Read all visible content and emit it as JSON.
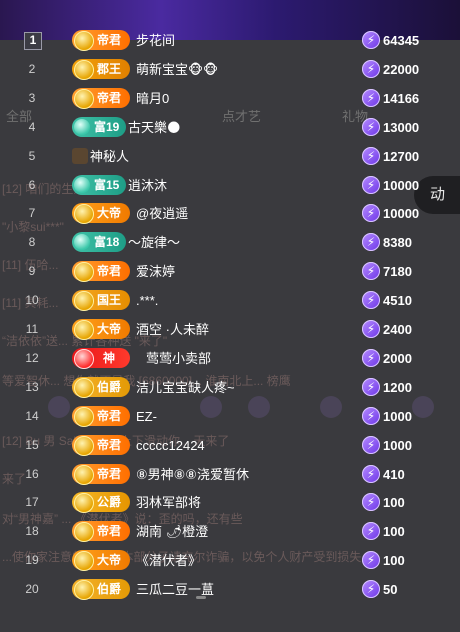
{
  "background_page": {
    "tabs": [
      "全部",
      "点才艺",
      "礼物"
    ],
    "live_button": "动",
    "chat_lines": [
      "[12] 咱们的生活",
      "\"小黎sui***\"",
      "[11] 伍哈...",
      "[11] 冥耗...",
      "“洁依依”送... 累计各种送 \"来了\"",
      "等爱智休... 想你就不是我 [6860000]...  淮南北上... 榜鹰",
      "[12] Bu 男 Salary 通过上下滑动你...  天来了",
      "来了",
      "对“男神嘉” ... 《潜伏者》说：歪的吗，还有些",
      "...使你家注意的... 金网本部分子请充尔诈骗，以免个人财产受到损失"
    ]
  },
  "rank_list": [
    {
      "rank": "1",
      "title": "帝君",
      "name": "步花间",
      "score": "64345",
      "badge": "dizun"
    },
    {
      "rank": "2",
      "title": "郡王",
      "name": "萌新宝宝🐵🐵",
      "score": "22000",
      "badge": "junwang"
    },
    {
      "rank": "3",
      "title": "帝君",
      "name": "暗月0",
      "score": "14166",
      "badge": "dizun"
    },
    {
      "rank": "4",
      "title": "富19",
      "name": "古天樂🌑",
      "score": "13000",
      "badge": "fu"
    },
    {
      "rank": "5",
      "title": "",
      "name": "神秘人",
      "score": "12700",
      "badge": "avatar"
    },
    {
      "rank": "6",
      "title": "富15",
      "name": "逍沐沐",
      "score": "10000",
      "badge": "fu"
    },
    {
      "rank": "7",
      "title": "大帝",
      "name": "@夜逍遥",
      "score": "10000",
      "badge": "dadi"
    },
    {
      "rank": "8",
      "title": "富18",
      "name": "～旋律～",
      "score": "8380",
      "badge": "fu"
    },
    {
      "rank": "9",
      "title": "帝君",
      "name": "爱沫婷",
      "score": "7180",
      "badge": "dizun"
    },
    {
      "rank": "10",
      "title": "国王",
      "name": ".***.",
      "score": "4510",
      "badge": "guowang"
    },
    {
      "rank": "11",
      "title": "大帝",
      "name": "酒空 ·人未醉",
      "score": "2400",
      "badge": "dadi"
    },
    {
      "rank": "12",
      "title": "神",
      "name": "莺莺小卖部",
      "score": "2000",
      "badge": "shen"
    },
    {
      "rank": "13",
      "title": "伯爵",
      "name": "洁儿宝宝缺人疼~",
      "score": "1200",
      "badge": "bojue"
    },
    {
      "rank": "14",
      "title": "帝君",
      "name": "EZ-",
      "score": "1000",
      "badge": "dizun"
    },
    {
      "rank": "15",
      "title": "帝君",
      "name": "ccccc12424",
      "score": "1000",
      "badge": "dizun"
    },
    {
      "rank": "16",
      "title": "帝君",
      "name": "⑧男神⑧⑧浇爱暂休",
      "score": "410",
      "badge": "dizun"
    },
    {
      "rank": "17",
      "title": "公爵",
      "name": "羽林军部将",
      "score": "100",
      "badge": "gongjue"
    },
    {
      "rank": "18",
      "title": "帝君",
      "name": "湖南 🌶橙澄",
      "score": "100",
      "badge": "dizun"
    },
    {
      "rank": "19",
      "title": "大帝",
      "name": "《潜伏者》",
      "score": "100",
      "badge": "dadi"
    },
    {
      "rank": "20",
      "title": "伯爵",
      "name": "三瓜二豆一蒀",
      "score": "50",
      "badge": "bojue"
    }
  ],
  "colors": {
    "accent_gold": "#ff8a00",
    "coin_purple": "#7a45ee",
    "fu_green": "#2fb59b",
    "shen_red": "#e8161a"
  }
}
